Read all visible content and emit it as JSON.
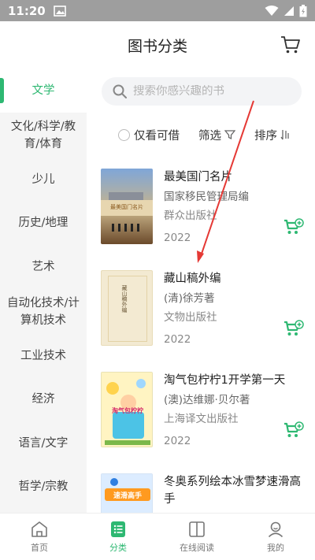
{
  "status": {
    "time": "11:20"
  },
  "header": {
    "title": "图书分类"
  },
  "sidebar": {
    "items": [
      {
        "label": "文学"
      },
      {
        "label": "文化/科学/教育/体育"
      },
      {
        "label": "少儿"
      },
      {
        "label": "历史/地理"
      },
      {
        "label": "艺术"
      },
      {
        "label": "自动化技术/计算机技术"
      },
      {
        "label": "工业技术"
      },
      {
        "label": "经济"
      },
      {
        "label": "语言/文字"
      },
      {
        "label": "哲学/宗教"
      }
    ]
  },
  "search": {
    "placeholder": "搜索你感兴趣的书"
  },
  "filters": {
    "available_label": "仅看可借",
    "filter_label": "筛选",
    "sort_label": "排序"
  },
  "books": [
    {
      "title": "最美国门名片",
      "author": "国家移民管理局编",
      "publisher": "群众出版社",
      "year": "2022",
      "cover_title": "最美国门名片"
    },
    {
      "title": "藏山稿外编",
      "author": "(清)徐芳著",
      "publisher": "文物出版社",
      "year": "2022",
      "cover_title": "藏山稿外编"
    },
    {
      "title": "淘气包柠柠1开学第一天",
      "author": "(澳)达维娜·贝尔著",
      "publisher": "上海译文出版社",
      "year": "2022",
      "cover_title": "淘气包柠柠"
    },
    {
      "title": "冬奥系列绘本冰雪梦速滑高手",
      "author": "",
      "publisher": "",
      "year": "",
      "cover_title": "速滑高手"
    }
  ],
  "tabbar": {
    "items": [
      {
        "label": "首页"
      },
      {
        "label": "分类"
      },
      {
        "label": "在线阅读"
      },
      {
        "label": "我的"
      }
    ]
  },
  "colors": {
    "accent": "#2eb872",
    "status_bar": "#9e9e9e",
    "annotation": "#e53935"
  }
}
